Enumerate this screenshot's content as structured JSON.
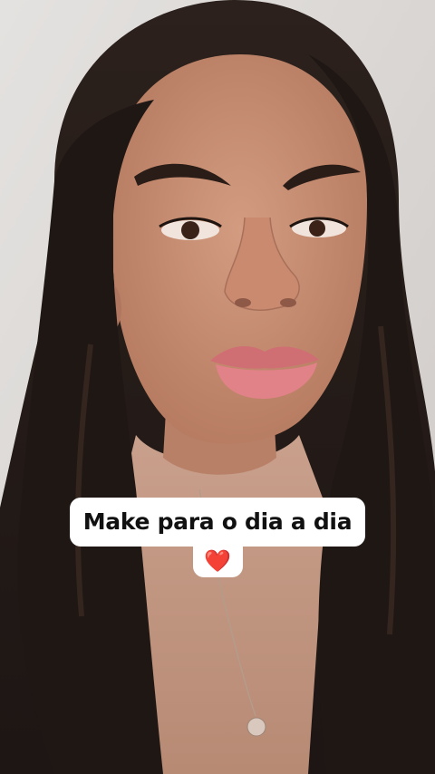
{
  "caption": {
    "line1": "Make para o dia a dia",
    "emoji": "❤️"
  },
  "colors": {
    "background_wall": "#d9d6d4",
    "hair": "#2a201c",
    "skin": "#c98f74",
    "lips": "#d9747a",
    "sweater": "#c89a85",
    "caption_bg": "#ffffff",
    "caption_text": "#111111"
  }
}
